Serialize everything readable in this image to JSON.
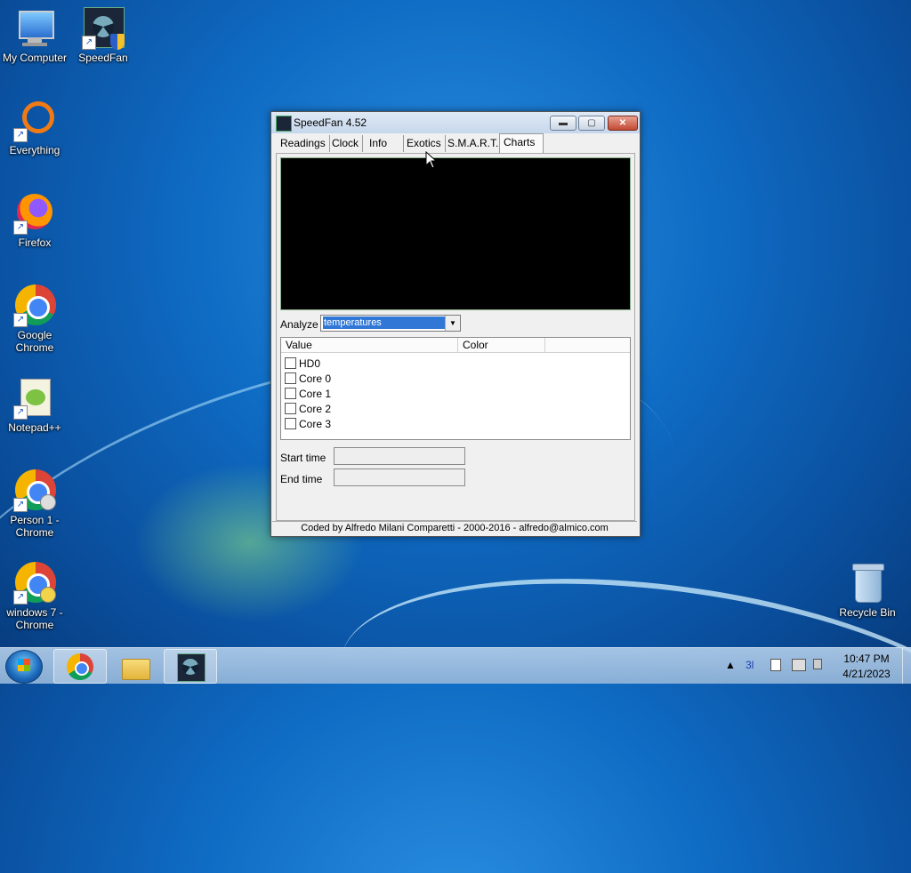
{
  "desktop": {
    "icons": [
      {
        "label": "My Computer",
        "icon": "my-computer-icon"
      },
      {
        "label": "SpeedFan",
        "icon": "speedfan-icon"
      },
      {
        "label": "Everything",
        "icon": "everything-icon"
      },
      {
        "label": "Firefox",
        "icon": "firefox-icon"
      },
      {
        "label": "Google Chrome",
        "icon": "chrome-icon"
      },
      {
        "label": "Notepad++",
        "icon": "notepadpp-icon"
      },
      {
        "label": "Person 1 - Chrome",
        "icon": "chrome-person-icon"
      },
      {
        "label": "windows 7 - Chrome",
        "icon": "chrome-profile-icon"
      },
      {
        "label": "Recycle Bin",
        "icon": "recycle-bin-icon"
      }
    ]
  },
  "window": {
    "title": "SpeedFan 4.52",
    "controls": {
      "minimize": "▬",
      "maximize": "▢",
      "close": "✕"
    },
    "tabs": [
      {
        "label": "Readings"
      },
      {
        "label": "Clock"
      },
      {
        "label": "Info"
      },
      {
        "label": "Exotics"
      },
      {
        "label": "S.M.A.R.T."
      },
      {
        "label": "Charts"
      }
    ],
    "active_tab": "Charts",
    "charts": {
      "analyze_label": "Analyze",
      "analyze_value": "temperatures",
      "columns": [
        "Value",
        "Color"
      ],
      "items": [
        {
          "label": "HD0",
          "checked": false
        },
        {
          "label": "Core 0",
          "checked": false
        },
        {
          "label": "Core 1",
          "checked": false
        },
        {
          "label": "Core 2",
          "checked": false
        },
        {
          "label": "Core 3",
          "checked": false
        }
      ],
      "start_time_label": "Start time",
      "end_time_label": "End time",
      "start_time_value": "",
      "end_time_value": ""
    },
    "status": "Coded by Alfredo Milani Comparetti - 2000-2016 - alfredo@almico.com"
  },
  "taskbar": {
    "tray": {
      "show_hidden": "▲",
      "ime": "3l",
      "time": "10:47 PM",
      "date": "4/21/2023"
    }
  },
  "colors": {
    "desktop_blue": "#0f6cc4",
    "chart_bg": "#000000",
    "selection": "#3178d6"
  }
}
